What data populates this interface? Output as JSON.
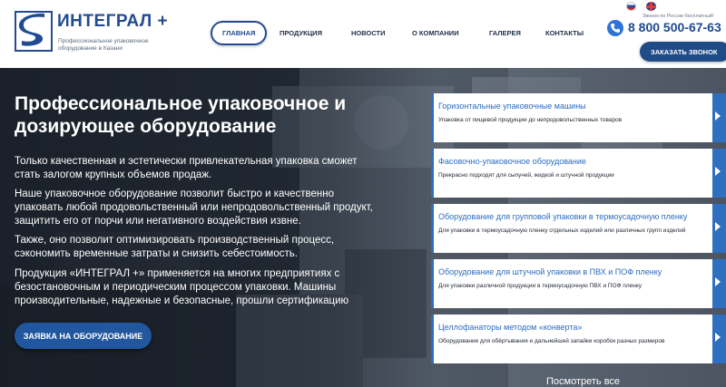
{
  "brand": {
    "name": "ИНТЕГРАЛ +",
    "tagline": "Профессиональное упаковочное оборудование в Казани"
  },
  "nav": {
    "items": [
      {
        "label": "Главная",
        "active": true
      },
      {
        "label": "Продукция",
        "active": false
      },
      {
        "label": "Новости",
        "active": false
      },
      {
        "label": "О компании",
        "active": false
      },
      {
        "label": "Галерея",
        "active": false
      },
      {
        "label": "Контакты",
        "active": false
      }
    ]
  },
  "contact": {
    "call_note": "Звонок по России бесплатный!",
    "phone": "8 800 500-67-63",
    "callback_label": "Заказать звонок",
    "icon": "phone-icon"
  },
  "languages": [
    "ru",
    "en"
  ],
  "hero": {
    "title": "Профессиональное упаковочное и дозирующее оборудование",
    "paragraphs": [
      "Только качественная и эстетически привлекательная упаковка сможет стать залогом крупных объемов продаж.",
      "Наше упаковочное оборудование позволит быстро и качественно упаковать любой продовольственный или непродовольственный продукт, защитить его от порчи или негативного воздействия извне.",
      "Также, оно позволит оптимизировать производственный процесс, сэкономить временные затраты и снизить себестоимость.",
      "Продукция «ИНТЕГРАЛ +» применяется на многих предприятиях с безостановочным и периодическим процессом упаковки. Машины производительные, надежные и безопасные, прошли сертификацию"
    ],
    "order_button": "Заявка на оборудование"
  },
  "products": [
    {
      "title": "Горизонтальные упаковочные машины",
      "desc": "Упаковка от пищевой продукции до непродовольственных товаров"
    },
    {
      "title": "Фасовочно-упаковочное оборудование",
      "desc": "Прекрасно подходят для сыпучей, жидкой и штучной продукции"
    },
    {
      "title": "Оборудование для групповой упаковки в термоусадочную пленку",
      "desc": "Для упаковки в термоусадочную пленку отдельных изделий или различных групп изделий"
    },
    {
      "title": "Оборудование для штучной упаковки в ПВХ и ПОФ пленку",
      "desc": "Для упаковки различной продукции в термоусадочную ПВХ и ПОФ пленку"
    },
    {
      "title": "Целлофанаторы методом «конверта»",
      "desc": "Оборудование для обёртывания и дальнейшей запайки коробок разных размеров"
    }
  ],
  "see_all": "Посмотреть все",
  "colors": {
    "brand_blue": "#234b92",
    "accent_blue": "#2e6fbd",
    "button_blue": "#21579e"
  }
}
